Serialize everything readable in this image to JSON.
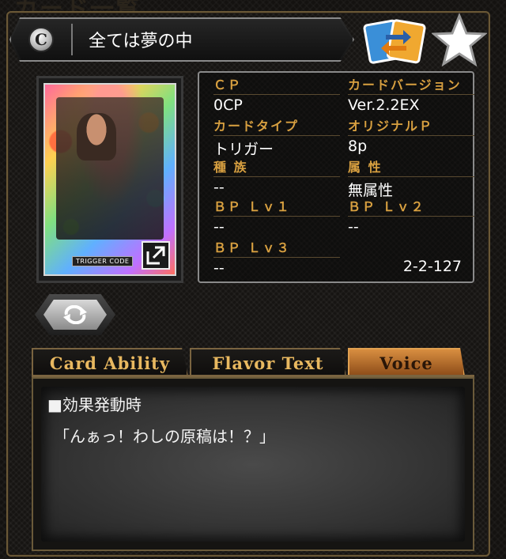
{
  "background_title": "カード一覧",
  "header": {
    "rarity": "C",
    "card_name": "全ては夢の中"
  },
  "card_image": {
    "trigger_label": "TRIGGER CODE"
  },
  "stats": {
    "cp_label": "ＣＰ",
    "cp_value": "0CP",
    "version_label": "カードバージョン",
    "version_value": "Ver.2.2EX",
    "type_label": "カードタイプ",
    "type_value": "トリガー",
    "original_p_label": "オリジナルＰ",
    "original_p_value": "8p",
    "tribe_label": "種 族",
    "tribe_value": "--",
    "attribute_label": "属 性",
    "attribute_value": "無属性",
    "bp1_label": "ＢＰ Ｌｖ１",
    "bp1_value": "--",
    "bp2_label": "ＢＰ Ｌｖ２",
    "bp2_value": "--",
    "bp3_label": "ＢＰ Ｌｖ３",
    "bp3_value": "--",
    "card_number": "2-2-127"
  },
  "tabs": {
    "ability": "Card Ability",
    "flavor": "Flavor Text",
    "voice": "Voice",
    "active": "voice"
  },
  "voice": {
    "heading": "■効果発動時",
    "line": "「んぁっ！わしの原稿は！？」"
  },
  "colors": {
    "accent_gold": "#d8a040",
    "active_tab": "#d88e40",
    "frame": "#6a5836"
  },
  "icons": {
    "rarity": "rarity-c-badge-icon",
    "swap": "swap-cards-icon",
    "favorite": "star-icon",
    "expand": "expand-icon",
    "toggle": "rotate-icon"
  }
}
